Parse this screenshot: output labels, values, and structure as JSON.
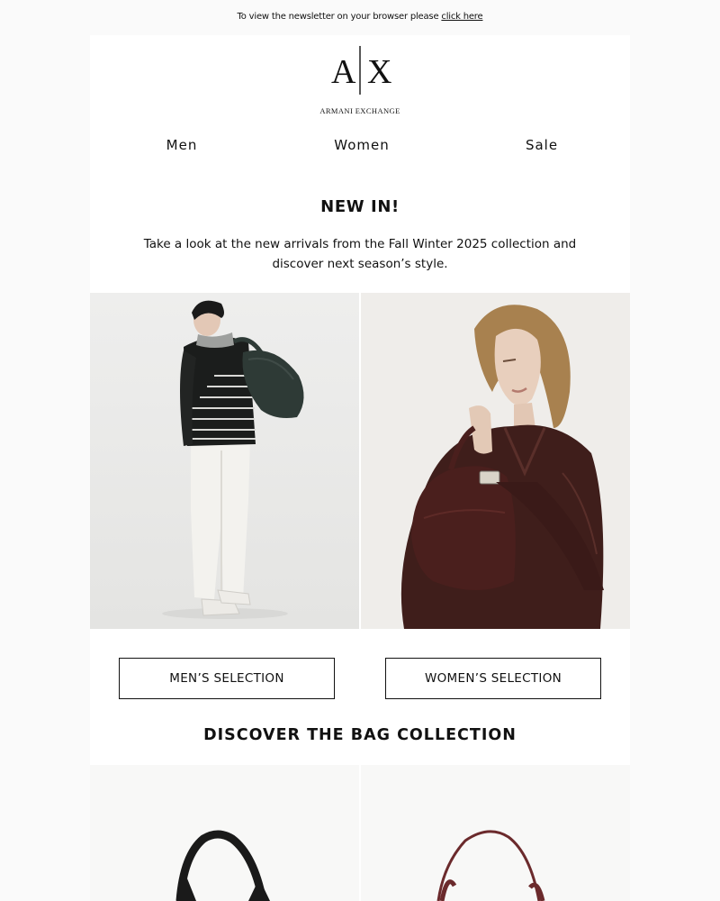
{
  "topbar": {
    "text": "To view the newsletter on your browser please ",
    "link": "click here"
  },
  "logo": {
    "mark_left": "A",
    "mark_right": "X",
    "subtitle": "ARMANI EXCHANGE"
  },
  "nav": {
    "items": [
      {
        "label": "Men"
      },
      {
        "label": "Women"
      },
      {
        "label": "Sale"
      }
    ]
  },
  "hero": {
    "headline": "NEW IN!",
    "intro": "Take a look at the new arrivals from the Fall Winter 2025 collection and discover next season’s style."
  },
  "selection": {
    "men_label": "MEN’S SELECTION",
    "women_label": "WOMEN’S SELECTION"
  },
  "bags": {
    "heading": "DISCOVER THE BAG COLLECTION"
  },
  "colors": {
    "page_background": "#fafafa",
    "card_background": "#ffffff",
    "text": "#111111",
    "men_sweater": "#1b1d1c",
    "men_bag": "#2e3a36",
    "women_jacket": "#3f1e1b",
    "women_bag": "#4a1f1d",
    "bag_black": "#1a1a1a",
    "bag_burgundy": "#6b2a2c"
  }
}
